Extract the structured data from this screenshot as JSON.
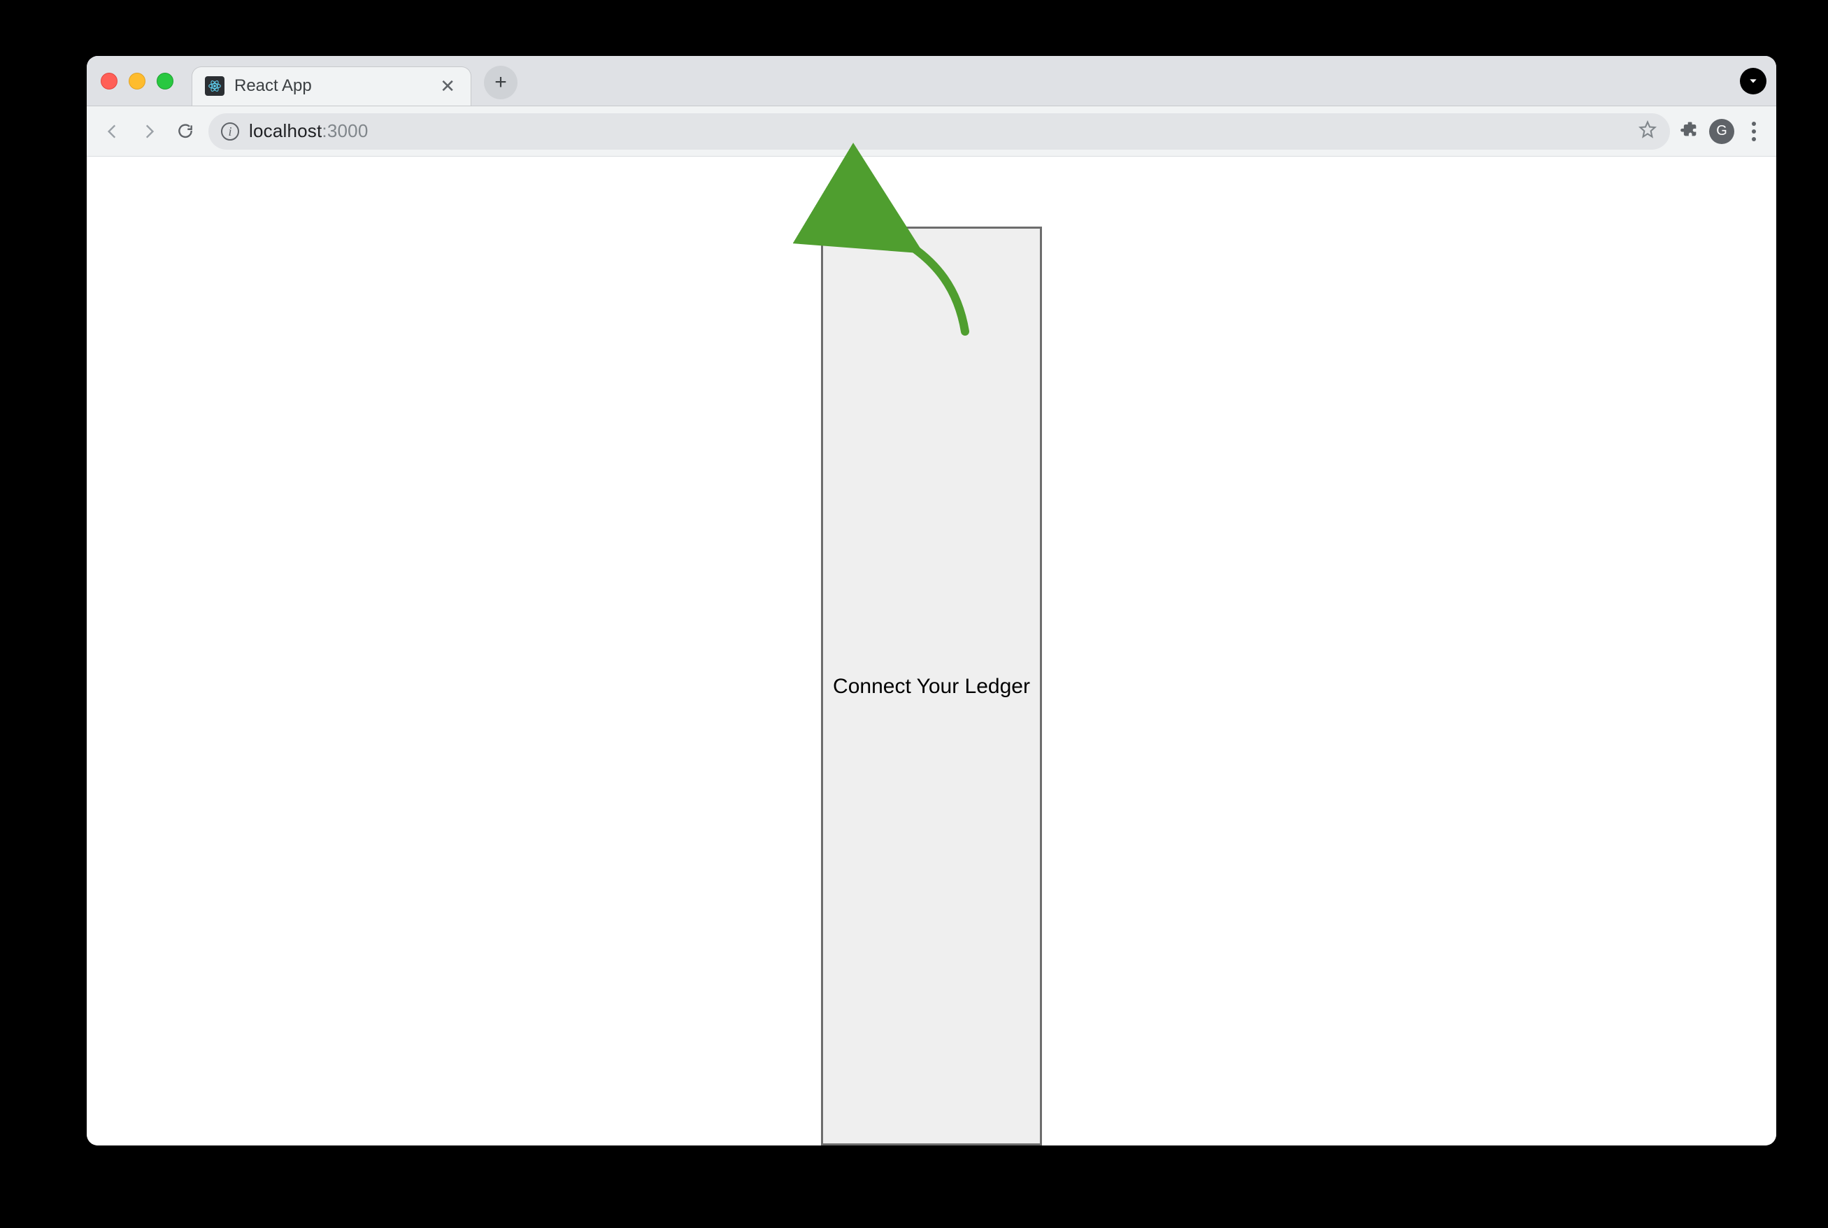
{
  "browser": {
    "tab": {
      "title": "React App"
    },
    "address": {
      "host": "localhost",
      "port": ":3000"
    },
    "avatar_initial": "G"
  },
  "page": {
    "connect_button": "Connect Your Ledger"
  }
}
